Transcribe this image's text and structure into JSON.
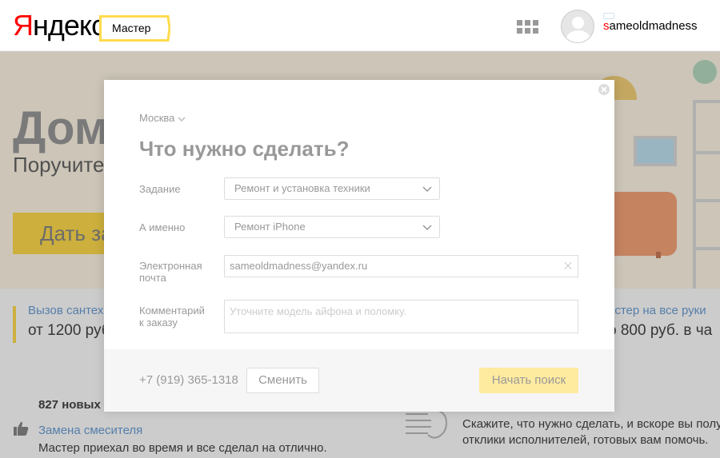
{
  "header": {
    "logo_first": "Я",
    "logo_rest": "ндекс",
    "service_tag": "Мастер",
    "username_first": "s",
    "username_rest": "ameoldmadness",
    "icons": [
      "apps-grid-icon",
      "avatar-icon",
      "chat-icon"
    ]
  },
  "page": {
    "hero_title": "Дома",
    "hero_subtitle": "Поручите",
    "hero_button": "Дать за",
    "promo_left_link": "Вызов сантех",
    "promo_left_price": "от 1200 руб",
    "promo_right_link": "астер на все руки",
    "promo_right_price": "о 800 руб. в ча",
    "reviews_count": "827 новых",
    "review_link": "Замена смесителя",
    "review_text": "Мастер приехал во время и все сделал на отлично.",
    "info_line1": "Скажите, что нужно сделать, и вскоре вы полу",
    "info_line2": "отклики исполнителей, готовых вам помочь."
  },
  "modal": {
    "city": "Москва",
    "title": "Что нужно сделать?",
    "task_label": "Задание",
    "task_value": "Ремонт и установка техники",
    "specific_label": "А именно",
    "specific_value": "Ремонт iPhone",
    "email_label_1": "Электронная",
    "email_label_2": "почта",
    "email_value": "sameoldmadness@yandex.ru",
    "comment_label_1": "Комментарий",
    "comment_label_2": "к заказу",
    "comment_placeholder": "Уточните модель айфона и поломку.",
    "phone": "+7 (919) 365-1318",
    "change_button": "Сменить",
    "search_button": "Начать поиск"
  },
  "colors": {
    "brand_red": "#ff0000",
    "brand_yellow": "#ffdb4d",
    "link_blue": "#6b9ed6"
  }
}
